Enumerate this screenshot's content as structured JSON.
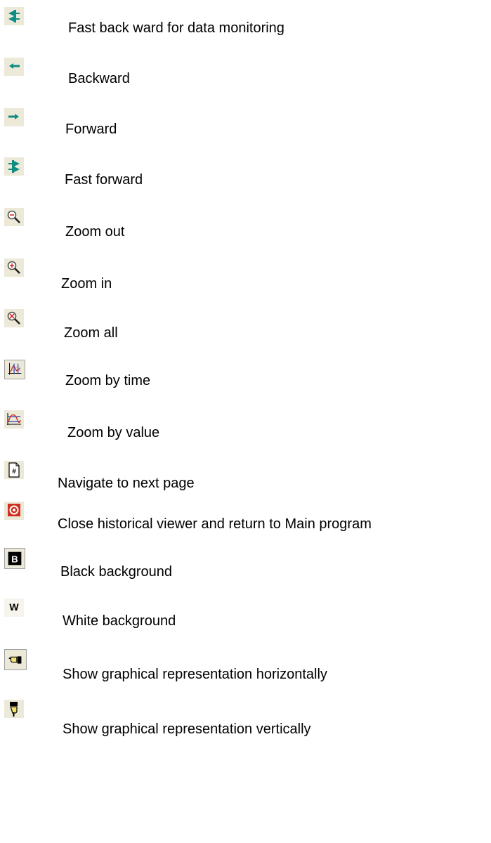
{
  "legend": {
    "items": [
      {
        "icon": "fast-backward-icon",
        "label": "Fast back ward for data monitoring"
      },
      {
        "icon": "backward-icon",
        "label": "Backward"
      },
      {
        "icon": "forward-icon",
        "label": "Forward"
      },
      {
        "icon": "fast-forward-icon",
        "label": "Fast forward"
      },
      {
        "icon": "zoom-out-icon",
        "label": "Zoom out"
      },
      {
        "icon": "zoom-in-icon",
        "label": "Zoom in"
      },
      {
        "icon": "zoom-all-icon",
        "label": "Zoom all"
      },
      {
        "icon": "zoom-by-time-icon",
        "label": "Zoom by time"
      },
      {
        "icon": "zoom-by-value-icon",
        "label": "Zoom by value"
      },
      {
        "icon": "next-page-icon",
        "label": "Navigate to next page"
      },
      {
        "icon": "close-icon",
        "label": "Close historical viewer and return to Main program"
      },
      {
        "icon": "black-background-icon",
        "label": "Black background"
      },
      {
        "icon": "white-background-icon",
        "label": "White background"
      },
      {
        "icon": "horizontal-hand-icon",
        "label": "Show graphical representation horizontally"
      },
      {
        "icon": "vertical-hand-icon",
        "label": "Show graphical representation vertically"
      }
    ]
  },
  "colors": {
    "teal": "#0f8c84",
    "icon_bg": "#ece9d8",
    "red": "#d03020",
    "blue": "#2040c0"
  }
}
